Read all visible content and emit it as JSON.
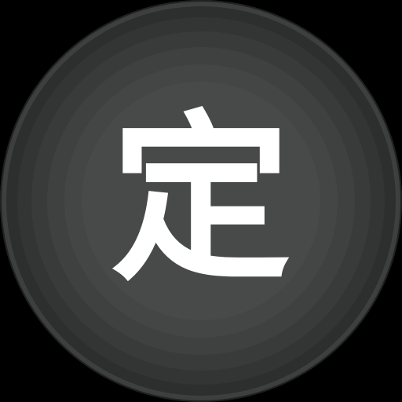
{
  "icon": {
    "glyph": "定",
    "glyph_color": "#ffffff",
    "background_outer_color": "#262827",
    "background_inner_color": "#4a4c4b",
    "shape": "circle"
  }
}
